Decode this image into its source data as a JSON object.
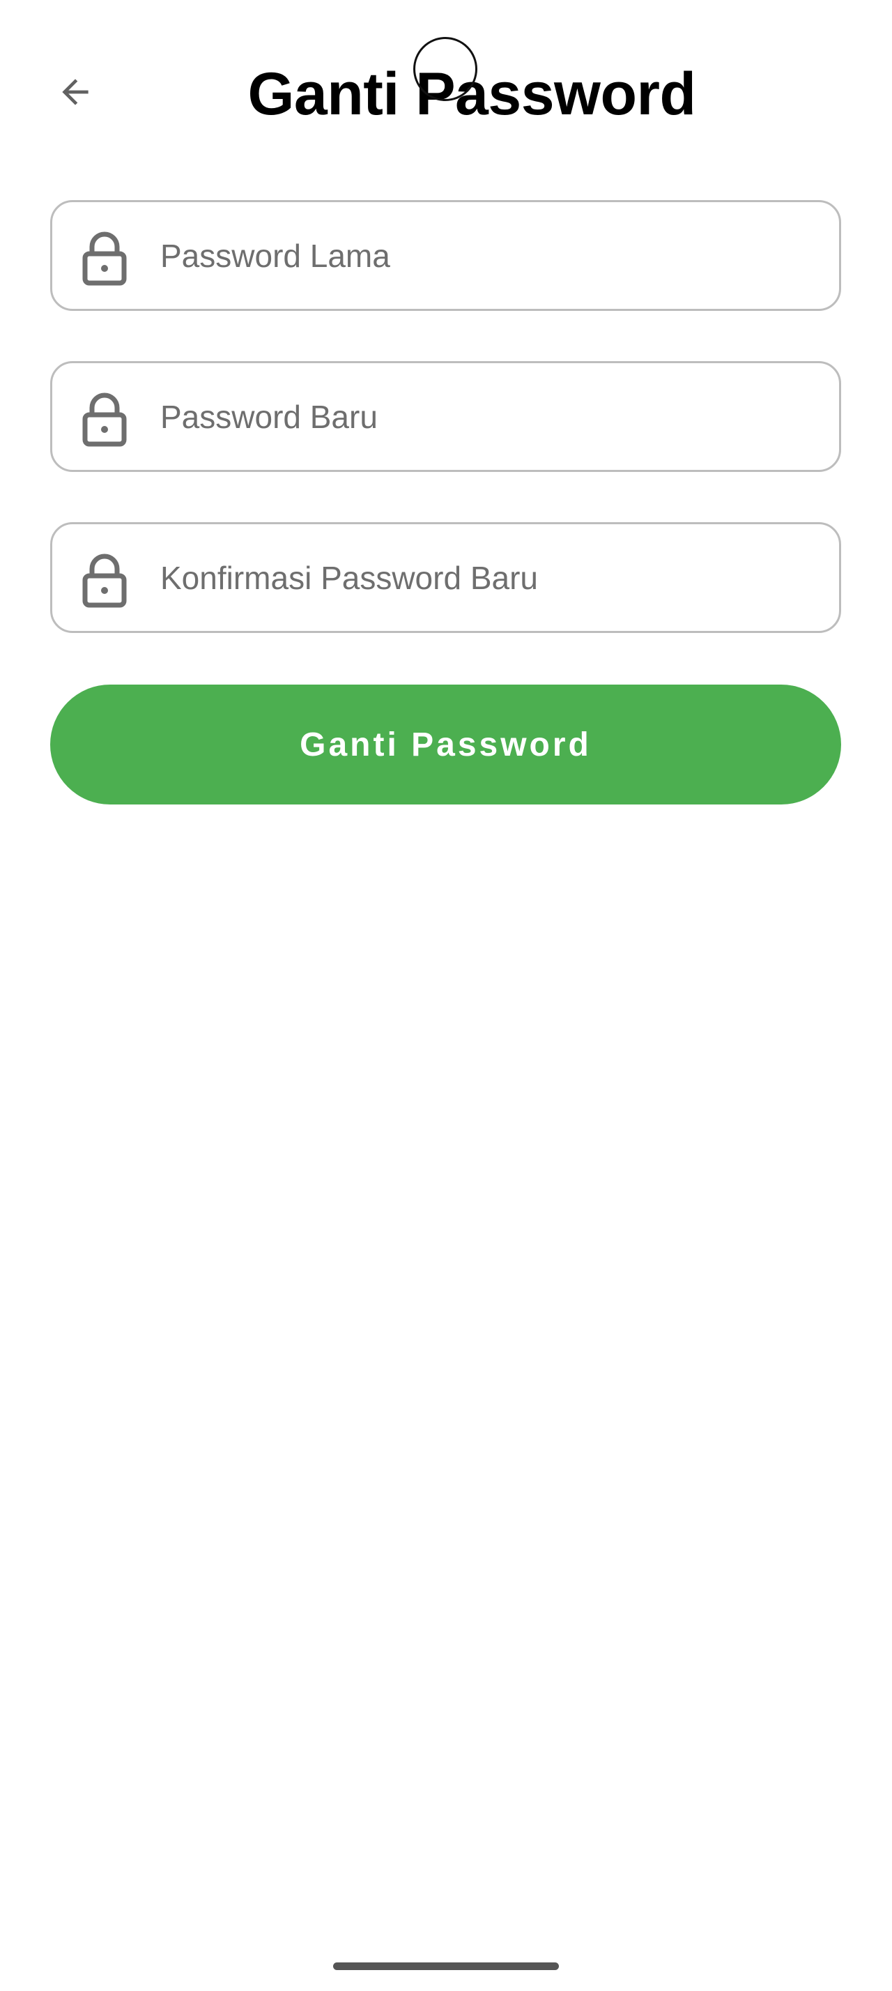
{
  "header": {
    "title": "Ganti Password",
    "back_icon": "arrow-left-icon"
  },
  "form": {
    "old_password": {
      "placeholder": "Password Lama",
      "value": "",
      "icon": "lock-icon"
    },
    "new_password": {
      "placeholder": "Password Baru",
      "value": "",
      "icon": "lock-icon"
    },
    "confirm_password": {
      "placeholder": "Konfirmasi Password Baru",
      "value": "",
      "icon": "lock-icon"
    },
    "submit_label": "Ganti Password"
  },
  "colors": {
    "accent": "#4caf50",
    "field_border": "#bdbdbd",
    "icon": "#6e6e6e",
    "title": "#000000"
  }
}
